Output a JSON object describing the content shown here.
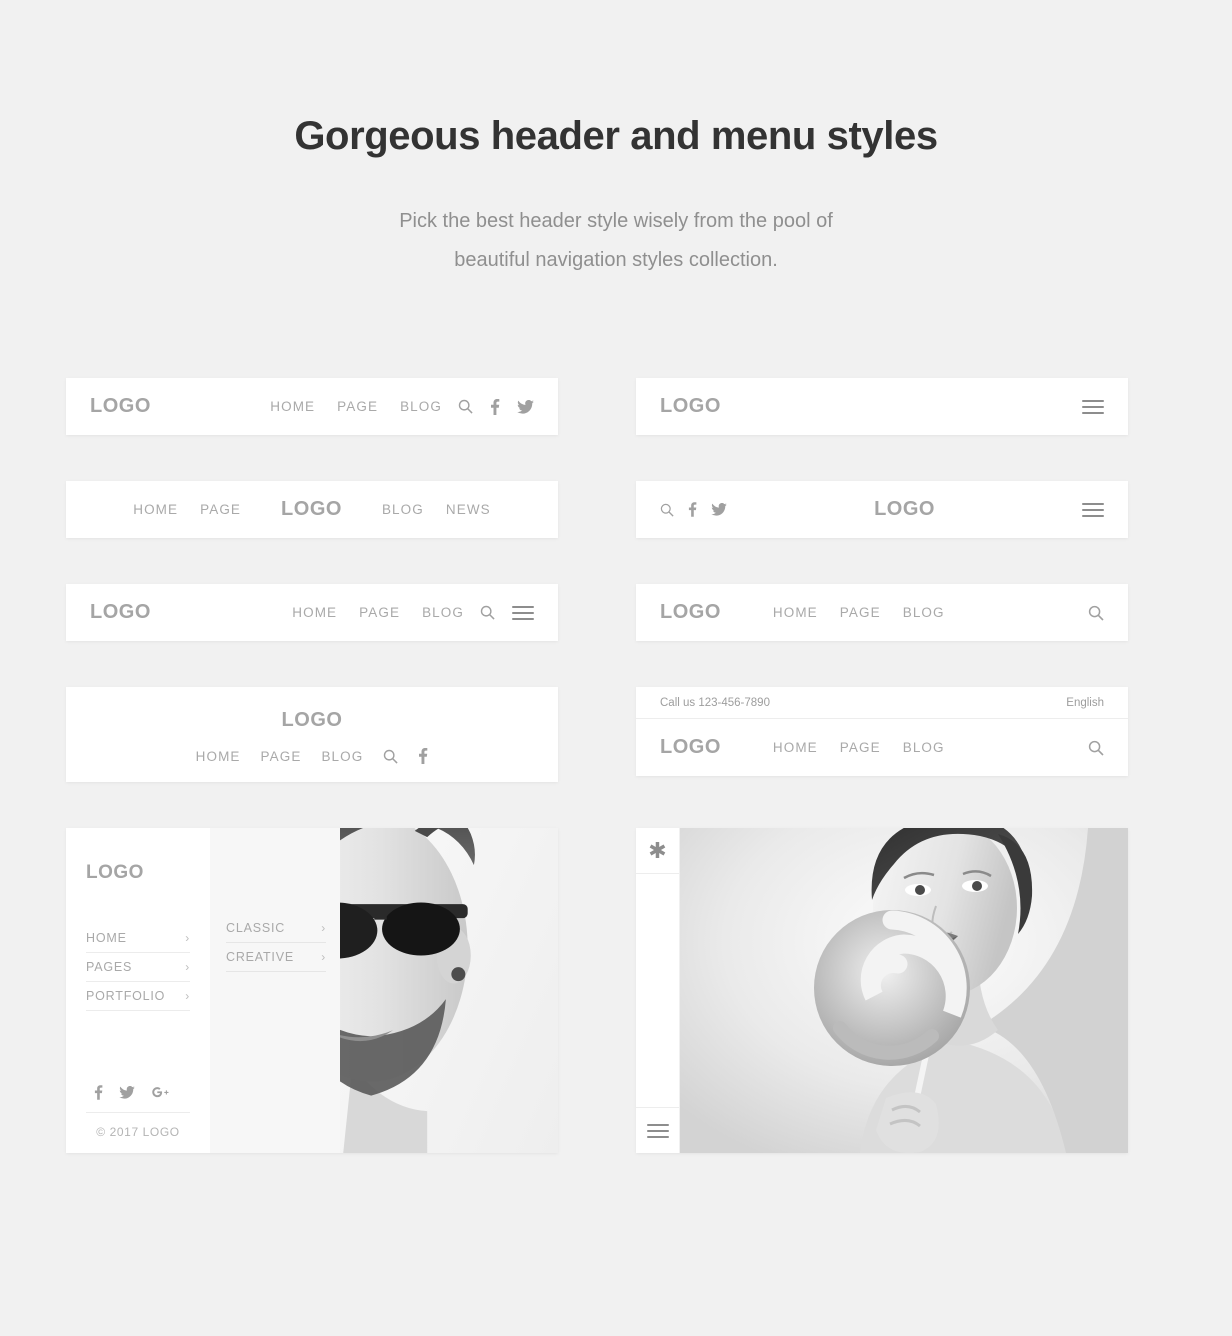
{
  "intro": {
    "title": "Gorgeous header and menu styles",
    "subtitle_line1": "Pick the best header style wisely from the pool of",
    "subtitle_line2": "beautiful navigation styles collection."
  },
  "common": {
    "logo": "LOGO",
    "home": "HOME",
    "page": "PAGE",
    "pages": "PAGES",
    "blog": "BLOG",
    "news": "NEWS",
    "portfolio": "PORTFOLIO",
    "classic": "CLASSIC",
    "creative": "CREATIVE",
    "chevron": "›"
  },
  "cards": {
    "logo_left_nav_social": {
      "logo": "LOGO",
      "nav": [
        "HOME",
        "PAGE",
        "BLOG"
      ],
      "icons": [
        "search-icon",
        "facebook-icon",
        "twitter-icon"
      ]
    },
    "logo_left_burger": {
      "logo": "LOGO",
      "icons": [
        "hamburger-icon"
      ]
    },
    "split_center_logo": {
      "left_nav": [
        "HOME",
        "PAGE"
      ],
      "logo": "LOGO",
      "right_nav": [
        "BLOG",
        "NEWS"
      ]
    },
    "social_left_center_logo_burger": {
      "logo": "LOGO",
      "icons": [
        "search-icon",
        "facebook-icon",
        "twitter-icon"
      ],
      "right_icons": [
        "hamburger-icon"
      ]
    },
    "logo_left_nav_search_burger": {
      "logo": "LOGO",
      "nav": [
        "HOME",
        "PAGE",
        "BLOG"
      ],
      "icons": [
        "search-icon",
        "hamburger-icon"
      ]
    },
    "logo_left_nav_search": {
      "logo": "LOGO",
      "nav": [
        "HOME",
        "PAGE",
        "BLOG"
      ],
      "icons": [
        "search-icon"
      ]
    },
    "stacked_center": {
      "logo": "LOGO",
      "nav": [
        "HOME",
        "PAGE",
        "BLOG"
      ],
      "icons": [
        "search-icon",
        "facebook-icon"
      ]
    },
    "topbar_header": {
      "call_us": "Call us 123-456-7890",
      "language": "English",
      "logo": "LOGO",
      "nav": [
        "HOME",
        "PAGE",
        "BLOG"
      ],
      "icons": [
        "search-icon"
      ]
    },
    "sidebar_showcase": {
      "logo": "LOGO",
      "menu": [
        "HOME",
        "PAGES",
        "PORTFOLIO"
      ],
      "submenu": [
        "CLASSIC",
        "CREATIVE"
      ],
      "social": [
        "facebook-icon",
        "twitter-icon",
        "google-plus-icon"
      ],
      "copyright": "© 2017  LOGO",
      "photo_alt": "bearded-man-sunglasses-photo"
    },
    "vertical_nav_showcase": {
      "brand_icon": "asterisk-icon",
      "menu_icon": "hamburger-icon",
      "photo_alt": "woman-with-lollipop-photo"
    }
  },
  "colors": {
    "page_background": "#f1f1f1",
    "card_background": "#ffffff",
    "heading": "#333333",
    "body_text": "#8f8f8f",
    "muted_text": "#a9a9a9",
    "logo_text": "#a5a5a5"
  }
}
